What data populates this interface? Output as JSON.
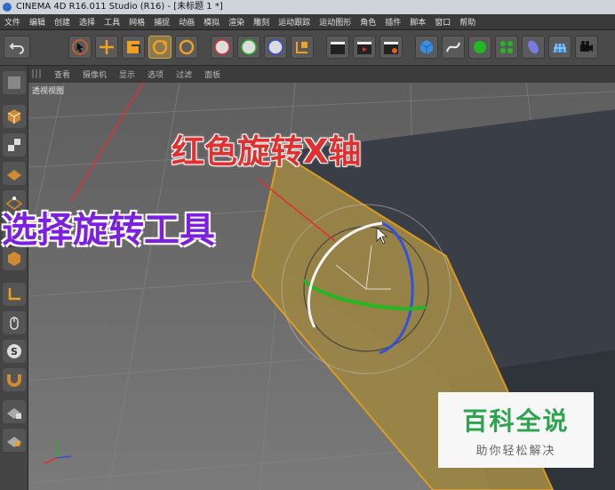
{
  "window": {
    "title": "CINEMA 4D R16.011 Studio (R16) - [未标题 1 *]"
  },
  "menu": [
    "文件",
    "编辑",
    "创建",
    "选择",
    "工具",
    "网格",
    "捕捉",
    "动画",
    "模拟",
    "渲染",
    "雕刻",
    "运动跟踪",
    "运动图形",
    "角色",
    "插件",
    "脚本",
    "窗口",
    "帮助"
  ],
  "toolbar": {
    "undo": "undo-icon",
    "axis_x": "X",
    "axis_y": "Y",
    "axis_z": "Z"
  },
  "viewport": {
    "menu": [
      "查看",
      "摄像机",
      "显示",
      "选项",
      "过滤",
      "面板"
    ],
    "label": "透视视图"
  },
  "annotations": {
    "red_axis": "红色旋转X轴",
    "select_tool": "选择旋转工具"
  },
  "watermark": {
    "title": "百科全说",
    "subtitle": "助你轻松解决"
  },
  "colors": {
    "rotate_x": "#e03030",
    "rotate_y": "#22b822",
    "rotate_z": "#3050e0",
    "selection": "#e0a020",
    "annotation_purple": "#7b1fe0"
  }
}
